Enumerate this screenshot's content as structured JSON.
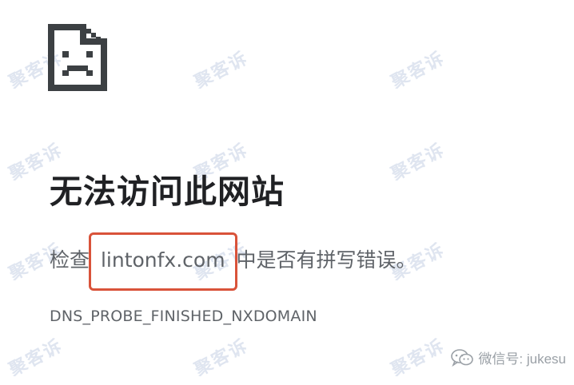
{
  "error_page": {
    "headline": "无法访问此网站",
    "suggestion_before": "检查 ",
    "domain": "lintonfx.com",
    "suggestion_after": " 中是否有拼写错误。",
    "error_code": "DNS_PROBE_FINISHED_NXDOMAIN",
    "icon": "sad-document-icon",
    "highlight_color": "#d9533a"
  },
  "watermark": {
    "text": "聚客诉"
  },
  "credit": {
    "icon": "wechat-icon",
    "text": "微信号: jukesu"
  }
}
